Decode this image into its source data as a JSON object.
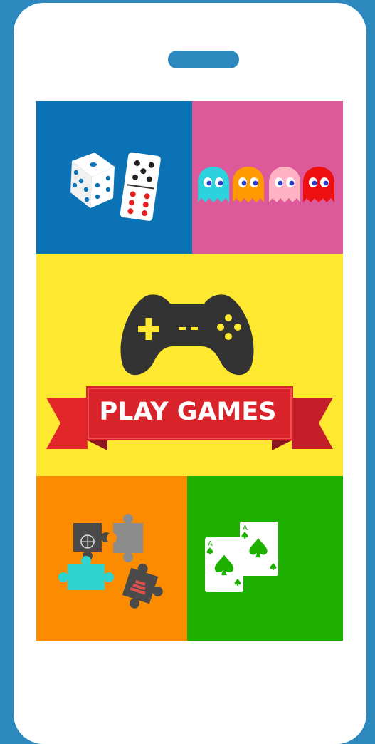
{
  "screen": {
    "title": "PLAY GAMES"
  },
  "colors": {
    "background": "#2d89bd",
    "phone_body": "#ffffff",
    "speaker": "#2d89bd",
    "dice_tile": "#0b72b6",
    "ghost_tile": "#dc5a99",
    "play_tile": "#ffe830",
    "puzzle_tile": "#fb8c00",
    "cards_tile": "#1db000",
    "ribbon": "#d8232a",
    "gamepad": "#333333"
  },
  "tiles": [
    {
      "id": "dice-dominoes",
      "icons": [
        "dice-icon",
        "domino-icon"
      ]
    },
    {
      "id": "ghosts",
      "icons": [
        "cyan-ghost-icon",
        "orange-ghost-icon",
        "pink-ghost-icon",
        "red-ghost-icon"
      ]
    },
    {
      "id": "play-games",
      "icons": [
        "gamepad-icon",
        "ribbon-banner"
      ]
    },
    {
      "id": "puzzle",
      "icons": [
        "puzzle-pieces-icon"
      ]
    },
    {
      "id": "cards",
      "icons": [
        "ace-of-spades-icon"
      ]
    }
  ],
  "cards": {
    "rank": "A"
  }
}
